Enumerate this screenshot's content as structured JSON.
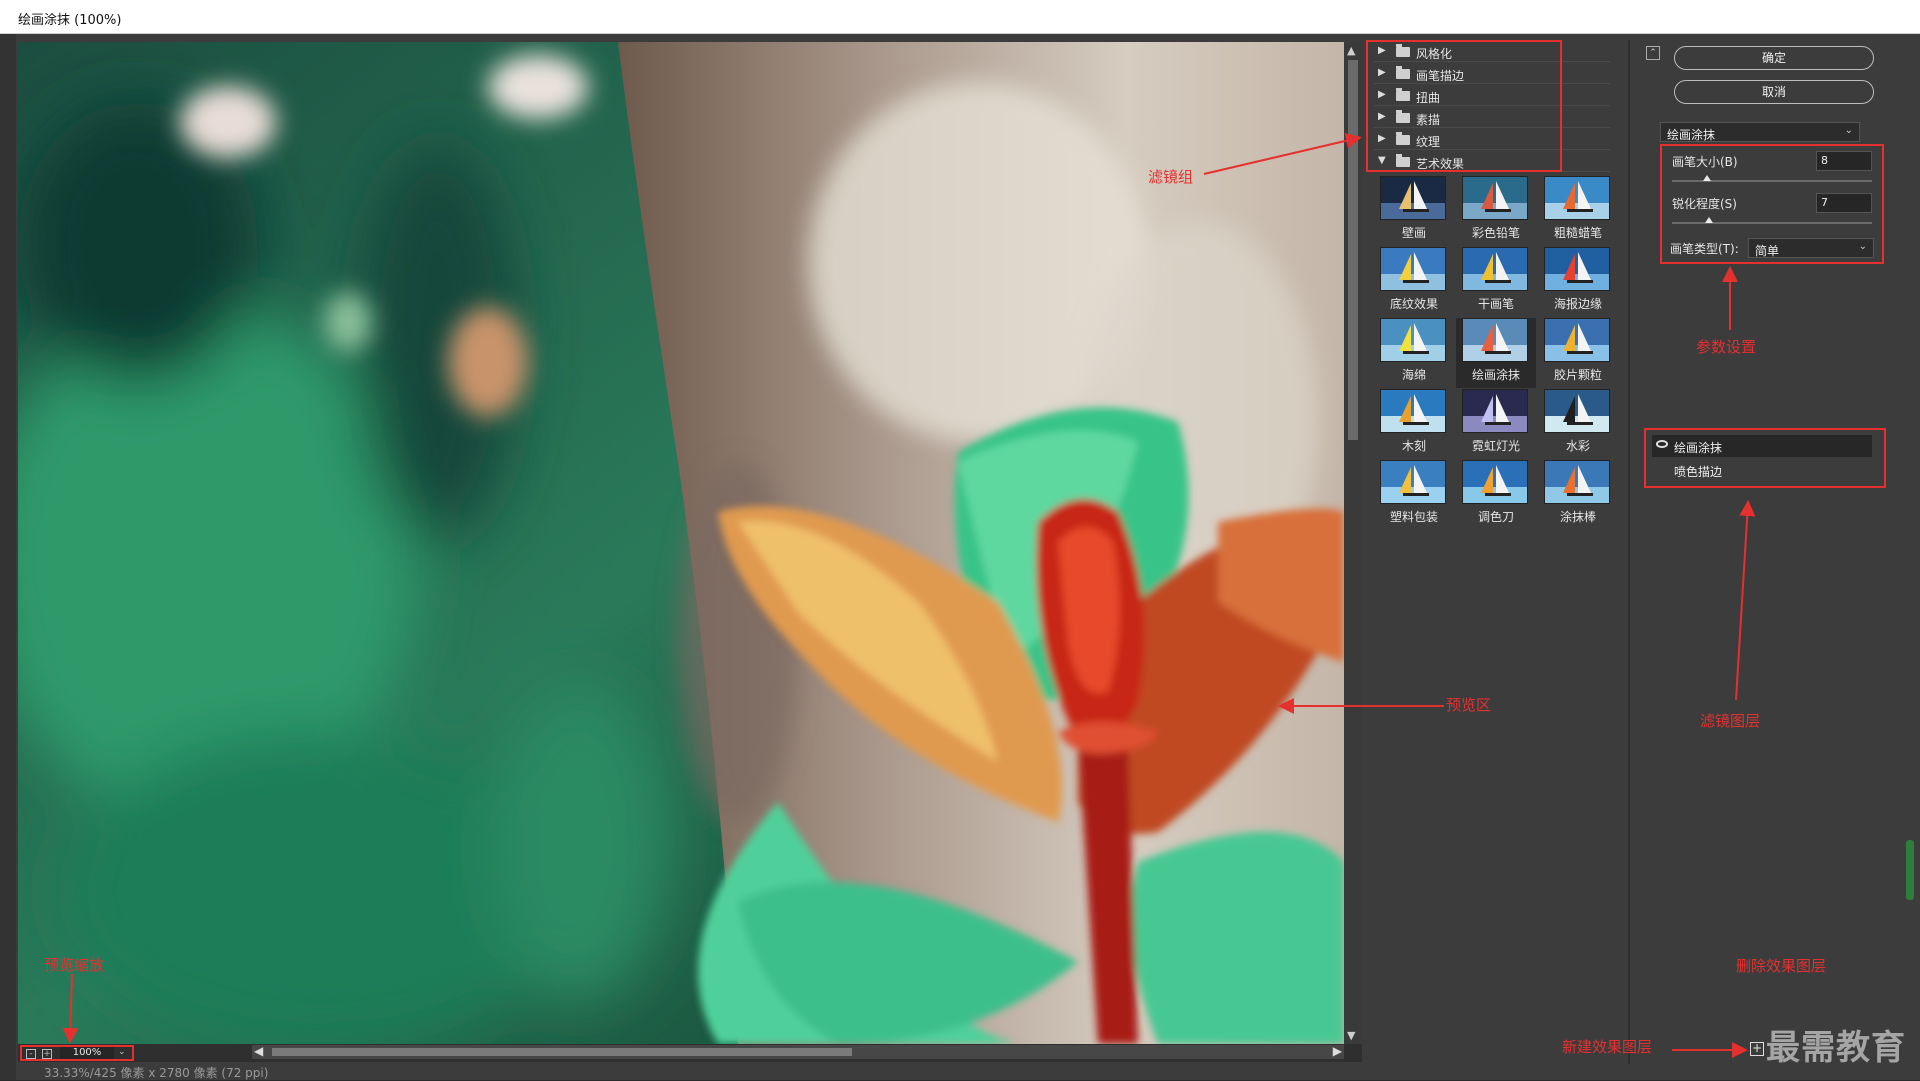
{
  "window": {
    "title": "绘画涂抹 (100%)"
  },
  "filter_categories": [
    {
      "label": "风格化",
      "expanded": false
    },
    {
      "label": "画笔描边",
      "expanded": false
    },
    {
      "label": "扭曲",
      "expanded": false
    },
    {
      "label": "素描",
      "expanded": false
    },
    {
      "label": "纹理",
      "expanded": false
    },
    {
      "label": "艺术效果",
      "expanded": true
    }
  ],
  "filter_thumbs": [
    "壁画",
    "彩色铅笔",
    "粗糙蜡笔",
    "底纹效果",
    "干画笔",
    "海报边缘",
    "海绵",
    "绘画涂抹",
    "胶片颗粒",
    "木刻",
    "霓虹灯光",
    "水彩",
    "塑料包装",
    "调色刀",
    "涂抹棒"
  ],
  "selected_filter": "绘画涂抹",
  "buttons": {
    "ok": "确定",
    "cancel": "取消"
  },
  "filter_dropdown": {
    "value": "绘画涂抹"
  },
  "params": {
    "brush_size": {
      "label": "画笔大小(B)",
      "value": "8",
      "fraction": 0.16
    },
    "sharpness": {
      "label": "锐化程度(S)",
      "value": "7",
      "fraction": 0.17
    },
    "brush_type": {
      "label": "画笔类型(T):",
      "value": "简单"
    }
  },
  "layers": [
    {
      "name": "绘画涂抹",
      "visible": true,
      "active": true
    },
    {
      "name": "喷色描边",
      "visible": false,
      "active": false
    }
  ],
  "zoom": {
    "value": "100%"
  },
  "status": {
    "text": "33.33%/425 像素 x 2780 像素 (72 ppi)"
  },
  "annotations": {
    "filter_group": "滤镜组",
    "param_settings": "参数设置",
    "preview_area": "预览区",
    "filter_layers": "滤镜图层",
    "preview_zoom": "预览缩放",
    "delete_layer": "删除效果图层",
    "new_layer": "新建效果图层"
  },
  "watermark": "最需教育",
  "colors": {
    "annotation_red": "#e53030",
    "panel_bg": "#3c3c3c"
  }
}
